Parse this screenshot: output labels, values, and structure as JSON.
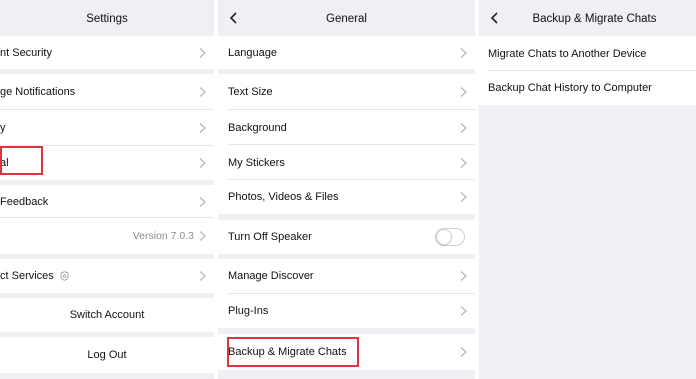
{
  "accent_highlight_color": "#d9363e",
  "panel1": {
    "title": "Settings",
    "items": [
      {
        "label": "nt Security"
      },
      {
        "label": "ge Notifications"
      },
      {
        "label": "y"
      },
      {
        "label": "al"
      },
      {
        "label": "Feedback"
      },
      {
        "label": "",
        "value": "Version 7.0.3"
      },
      {
        "label": "ct Services"
      },
      {
        "label": "Switch Account"
      },
      {
        "label": "Log Out"
      }
    ]
  },
  "panel2": {
    "title": "General",
    "items": [
      {
        "label": "Language"
      },
      {
        "label": "Text Size"
      },
      {
        "label": "Background"
      },
      {
        "label": "My Stickers"
      },
      {
        "label": "Photos, Videos & Files"
      },
      {
        "label": "Turn Off Speaker"
      },
      {
        "label": "Manage Discover"
      },
      {
        "label": "Plug-Ins"
      },
      {
        "label": "Backup & Migrate Chats"
      }
    ]
  },
  "panel3": {
    "title": "Backup & Migrate Chats",
    "items": [
      {
        "label": "Migrate Chats to Another Device"
      },
      {
        "label": "Backup Chat History to Computer"
      }
    ]
  }
}
